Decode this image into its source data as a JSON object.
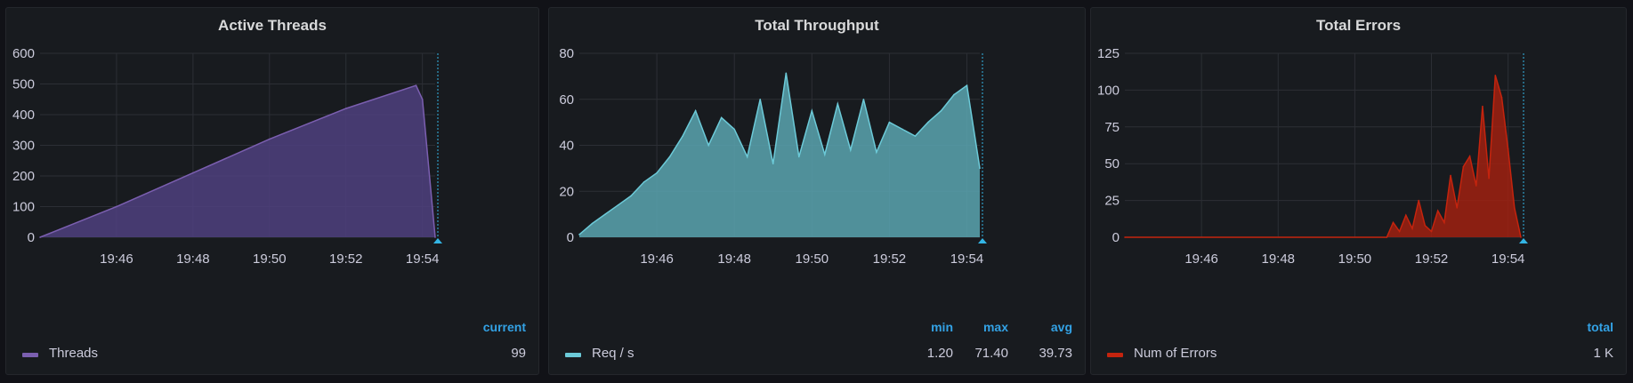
{
  "panels": [
    {
      "title": "Active Threads",
      "legend": {
        "headers": [
          "current"
        ],
        "series": [
          {
            "name": "Threads",
            "color": "#7b5fb0",
            "values": [
              "99"
            ]
          }
        ]
      }
    },
    {
      "title": "Total Throughput",
      "legend": {
        "headers": [
          "min",
          "max",
          "avg"
        ],
        "series": [
          {
            "name": "Req / s",
            "color": "#6ccad8",
            "values": [
              "1.20",
              "71.40",
              "39.73"
            ]
          }
        ]
      }
    },
    {
      "title": "Total Errors",
      "legend": {
        "headers": [
          "total"
        ],
        "series": [
          {
            "name": "Num of Errors",
            "color": "#c4240e",
            "values": [
              "1 K"
            ]
          }
        ]
      }
    }
  ],
  "chart_data": [
    {
      "type": "area",
      "title": "Active Threads",
      "x_ticks": [
        "19:46",
        "19:48",
        "19:50",
        "19:52",
        "19:54"
      ],
      "y_ticks": [
        0,
        100,
        200,
        300,
        400,
        500,
        600
      ],
      "ylim": [
        0,
        600
      ],
      "xlim": [
        "19:44:00",
        "19:54:20"
      ],
      "grid": true,
      "legend_position": "bottom",
      "colors": {
        "fill": "#4f3f7f",
        "line": "#7b5fb0"
      },
      "series": [
        {
          "name": "Threads",
          "x": [
            "19:44:00",
            "19:46:00",
            "19:48:00",
            "19:50:00",
            "19:52:00",
            "19:53:50",
            "19:54:00",
            "19:54:20"
          ],
          "y": [
            0,
            100,
            210,
            320,
            420,
            495,
            450,
            0
          ]
        }
      ]
    },
    {
      "type": "area",
      "title": "Total Throughput",
      "x_ticks": [
        "19:46",
        "19:48",
        "19:50",
        "19:52",
        "19:54"
      ],
      "y_ticks": [
        0,
        20,
        40,
        60,
        80
      ],
      "ylim": [
        0,
        80
      ],
      "xlim": [
        "19:44:00",
        "19:54:20"
      ],
      "grid": true,
      "legend_position": "bottom",
      "colors": {
        "fill": "#5aa5b0",
        "line": "#6ccad8"
      },
      "series": [
        {
          "name": "Req / s",
          "x": [
            "19:44:00",
            "19:44:20",
            "19:44:40",
            "19:45:00",
            "19:45:20",
            "19:45:40",
            "19:46:00",
            "19:46:20",
            "19:46:40",
            "19:47:00",
            "19:47:20",
            "19:47:40",
            "19:48:00",
            "19:48:20",
            "19:48:40",
            "19:49:00",
            "19:49:20",
            "19:49:40",
            "19:50:00",
            "19:50:20",
            "19:50:40",
            "19:51:00",
            "19:51:20",
            "19:51:40",
            "19:52:00",
            "19:52:20",
            "19:52:40",
            "19:53:00",
            "19:53:20",
            "19:53:40",
            "19:54:00",
            "19:54:20"
          ],
          "y": [
            1.2,
            6,
            10,
            14,
            18,
            24,
            28,
            35,
            44,
            55,
            40,
            52,
            47,
            35,
            60,
            32,
            71.4,
            35,
            55,
            36,
            58,
            38,
            60,
            37,
            50,
            47,
            44,
            50,
            55,
            62,
            66,
            30
          ]
        }
      ]
    },
    {
      "type": "area",
      "title": "Total Errors",
      "x_ticks": [
        "19:46",
        "19:48",
        "19:50",
        "19:52",
        "19:54"
      ],
      "y_ticks": [
        0,
        25,
        50,
        75,
        100,
        125
      ],
      "ylim": [
        0,
        125
      ],
      "xlim": [
        "19:44:00",
        "19:54:20"
      ],
      "grid": true,
      "legend_position": "bottom",
      "colors": {
        "fill": "#a02010",
        "line": "#c4240e"
      },
      "series": [
        {
          "name": "Num of Errors",
          "x": [
            "19:44:00",
            "19:50:50",
            "19:51:00",
            "19:51:10",
            "19:51:20",
            "19:51:30",
            "19:51:40",
            "19:51:50",
            "19:52:00",
            "19:52:10",
            "19:52:20",
            "19:52:30",
            "19:52:40",
            "19:52:50",
            "19:53:00",
            "19:53:10",
            "19:53:20",
            "19:53:30",
            "19:53:40",
            "19:53:50",
            "19:54:00",
            "19:54:10",
            "19:54:20"
          ],
          "y": [
            0,
            0,
            10,
            4,
            15,
            6,
            25,
            8,
            4,
            18,
            10,
            42,
            20,
            48,
            55,
            35,
            89,
            40,
            110,
            95,
            60,
            20,
            0
          ]
        }
      ]
    }
  ]
}
